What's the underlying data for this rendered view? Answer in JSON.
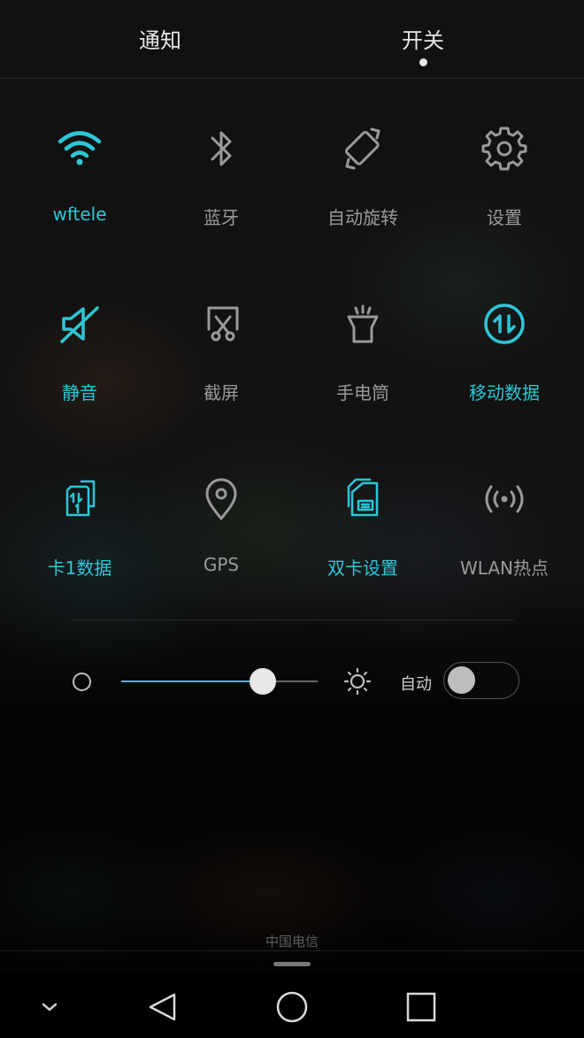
{
  "tabs": {
    "notifications": "通知",
    "switches": "开关"
  },
  "toggles": [
    {
      "label": "wftele",
      "icon": "wifi-icon",
      "active": true
    },
    {
      "label": "蓝牙",
      "icon": "bluetooth-icon",
      "active": false
    },
    {
      "label": "自动旋转",
      "icon": "auto-rotate-icon",
      "active": false
    },
    {
      "label": "设置",
      "icon": "gear-icon",
      "active": false
    },
    {
      "label": "静音",
      "icon": "mute-icon",
      "active": true
    },
    {
      "label": "截屏",
      "icon": "screenshot-icon",
      "active": false
    },
    {
      "label": "手电筒",
      "icon": "flashlight-icon",
      "active": false
    },
    {
      "label": "移动数据",
      "icon": "mobile-data-icon",
      "active": true
    },
    {
      "label": "卡1数据",
      "icon": "sim1-data-icon",
      "active": true
    },
    {
      "label": "GPS",
      "icon": "location-pin-icon",
      "active": false
    },
    {
      "label": "双卡设置",
      "icon": "dual-sim-icon",
      "active": true
    },
    {
      "label": "WLAN热点",
      "icon": "hotspot-icon",
      "active": false
    }
  ],
  "brightness": {
    "level": 0.72,
    "auto_label": "自动",
    "auto_enabled": false
  },
  "status": {
    "carrier": "中国电信"
  },
  "colors": {
    "accent": "#2ec6d6",
    "inactive": "#9a9a9a"
  },
  "navbar": {
    "icons": [
      "chevron-down-icon",
      "back-icon",
      "home-icon",
      "recents-icon"
    ]
  }
}
